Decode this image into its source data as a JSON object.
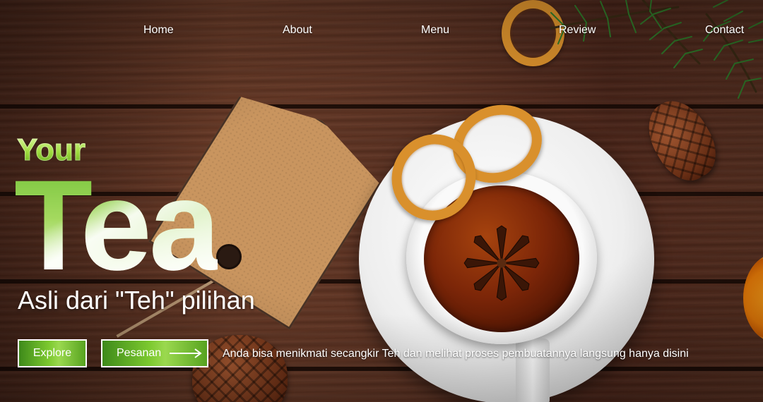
{
  "nav": {
    "items": [
      {
        "label": "Home"
      },
      {
        "label": "About"
      },
      {
        "label": "Menu"
      },
      {
        "label": "Review"
      },
      {
        "label": "Contact"
      }
    ]
  },
  "hero": {
    "pre_title": "Your",
    "title": "Tea",
    "tagline": "Asli dari \"Teh\" pilihan",
    "description": "Anda bisa menikmati secangkir Teh dan melihat proses pembuatannya langsung hanya disini"
  },
  "buttons": {
    "explore_label": "Explore",
    "order_label": "Pesanan"
  },
  "icons": {
    "order_arrow": "long-arrow-right-icon"
  },
  "colors": {
    "accent_green": "#7cc92f",
    "text": "#ffffff",
    "wood": "#5b3121"
  }
}
